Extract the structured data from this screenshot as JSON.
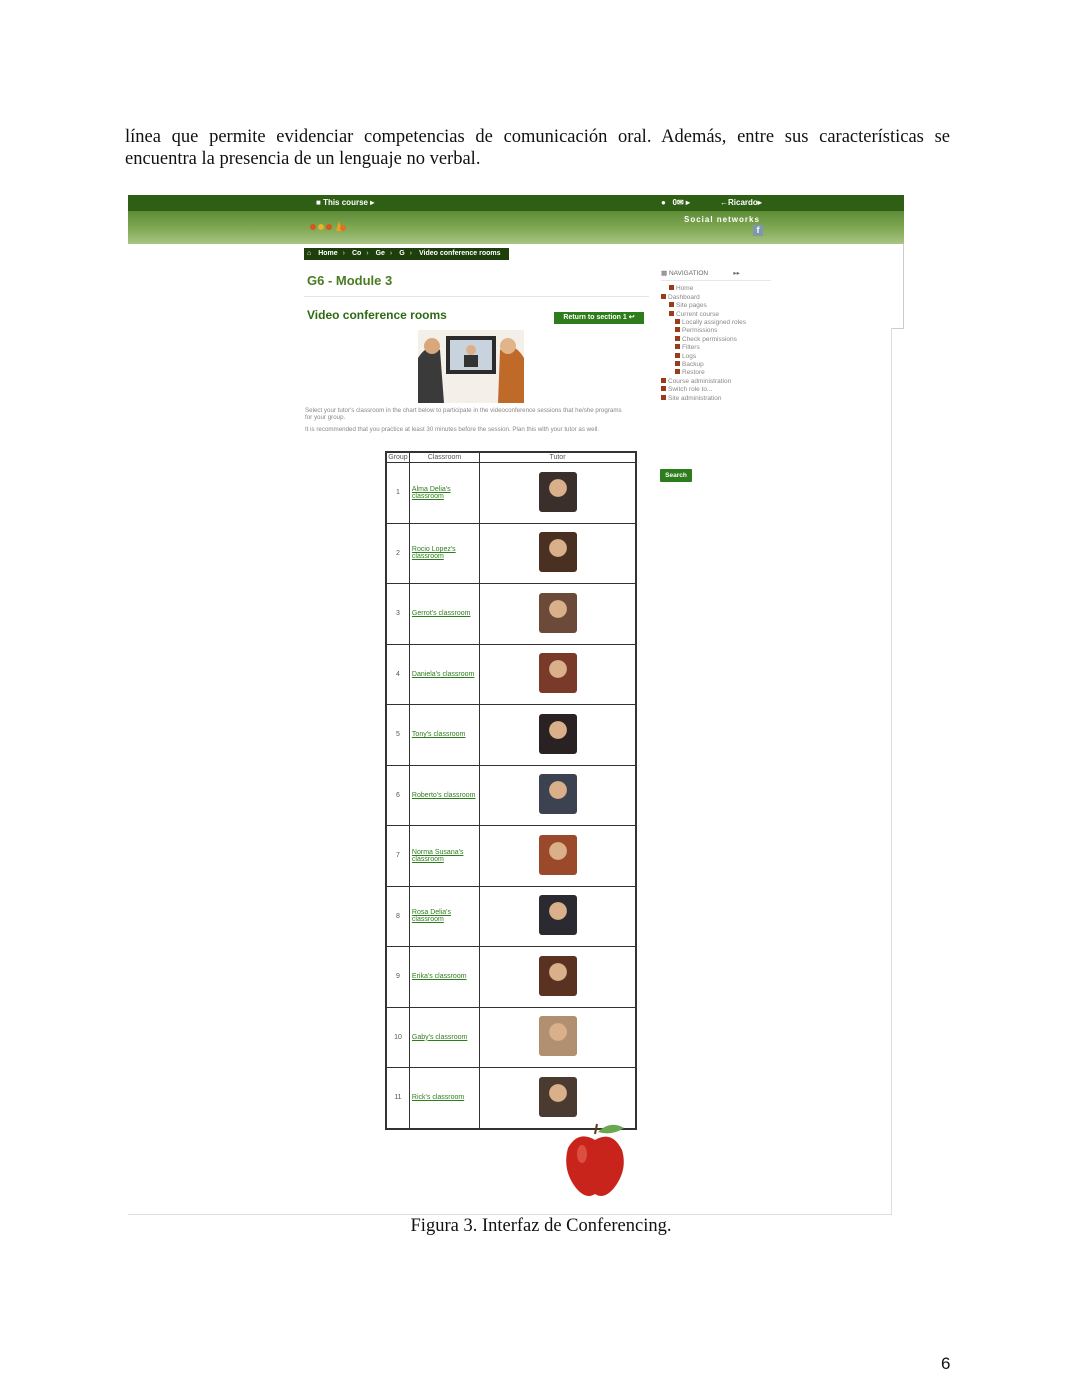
{
  "body_text": {
    "line1": "línea que permite evidenciar competencias de comunicación oral. Además, entre sus características se",
    "line2": "encuentra la presencia de un lenguaje no verbal."
  },
  "figure": {
    "caption": "Figura 3. Interfaz de Conferencing.",
    "topbar": {
      "course_menu": "This course",
      "icons_text": "0",
      "user_menu": "Ricardo"
    },
    "banner": {
      "social_label": "Social networks",
      "fb_label": "f"
    },
    "breadcrumb": [
      "Home",
      "Co",
      "Ge",
      "G",
      "Video conference rooms"
    ],
    "page_title": "G6 - Module 3",
    "section_title": "Video conference rooms",
    "return_button": "Return to section 1",
    "intro": {
      "p1": "Select your tutor's classroom in the chart below to participate in the videoconference sessions that he/she programs for your group.",
      "p2": "It is recommended that you practice at least 30 minutes before the session. Plan this with your tutor as well."
    },
    "table": {
      "headers": [
        "Group",
        "Classroom",
        "Tutor"
      ],
      "rows": [
        {
          "group": "1",
          "classroom": "Alma Delia's classroom",
          "avatar_color": "#3a2f2a"
        },
        {
          "group": "2",
          "classroom": "Rocio Lopez's classroom",
          "avatar_color": "#4a3020"
        },
        {
          "group": "3",
          "classroom": "Gerrot's classroom",
          "avatar_color": "#6b4a3a"
        },
        {
          "group": "4",
          "classroom": "Daniela's classroom",
          "avatar_color": "#7a3a2a"
        },
        {
          "group": "5",
          "classroom": "Tony's classroom",
          "avatar_color": "#2a2222"
        },
        {
          "group": "6",
          "classroom": "Roberto's classroom",
          "avatar_color": "#3c4250"
        },
        {
          "group": "7",
          "classroom": "Norma Susana's classroom",
          "avatar_color": "#9a4a2a"
        },
        {
          "group": "8",
          "classroom": "Rosa Delia's classroom",
          "avatar_color": "#2a2a30"
        },
        {
          "group": "9",
          "classroom": "Erika's classroom",
          "avatar_color": "#5a3222"
        },
        {
          "group": "10",
          "classroom": "Gaby's classroom",
          "avatar_color": "#b09070"
        },
        {
          "group": "11",
          "classroom": "Rick's classroom",
          "avatar_color": "#4a3a30"
        }
      ]
    },
    "navigation": {
      "heading": "NAVIGATION",
      "items": [
        {
          "label": "Home",
          "level": 1
        },
        {
          "label": "Dashboard",
          "level": 0
        },
        {
          "label": "Site pages",
          "level": 1
        },
        {
          "label": "Current course",
          "level": 1
        },
        {
          "label": "Locally assigned roles",
          "level": 2
        },
        {
          "label": "Permissions",
          "level": 2
        },
        {
          "label": "Check permissions",
          "level": 2
        },
        {
          "label": "Filters",
          "level": 2
        },
        {
          "label": "Logs",
          "level": 2
        },
        {
          "label": "Backup",
          "level": 2
        },
        {
          "label": "Restore",
          "level": 2
        },
        {
          "label": "Course administration",
          "level": 0
        },
        {
          "label": "Switch role to...",
          "level": 0
        },
        {
          "label": "Site administration",
          "level": 0
        }
      ]
    },
    "search_button": "Search"
  },
  "page_number": "6"
}
